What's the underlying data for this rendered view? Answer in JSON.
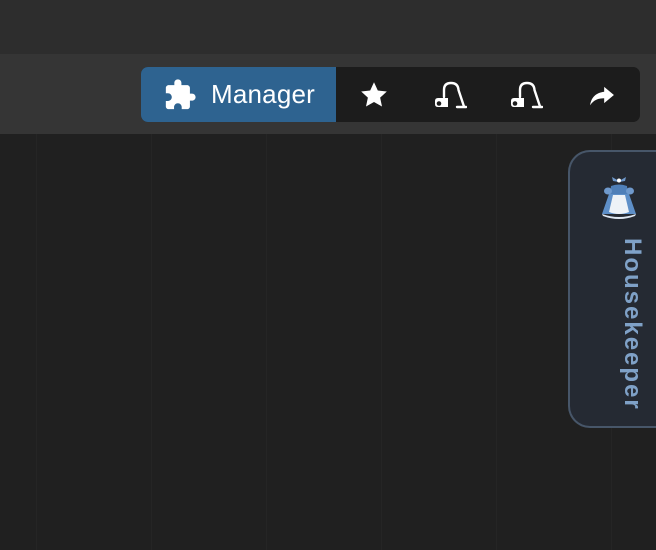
{
  "toolbar": {
    "manager_label": "Manager",
    "icons": {
      "manager": "puzzle-icon",
      "favorites": "star-icon",
      "clean_1": "vacuum-icon",
      "clean_2": "vacuum-icon",
      "share": "share-arrow-icon"
    },
    "colors": {
      "manager_bg": "#2e6390",
      "group_bg": "#1c1c1c",
      "icon": "#ffffff"
    }
  },
  "side_panel": {
    "label": "Housekeeper",
    "icon": "maid-dress-icon",
    "colors": {
      "text": "#7fa1c7",
      "border": "#475669"
    }
  }
}
